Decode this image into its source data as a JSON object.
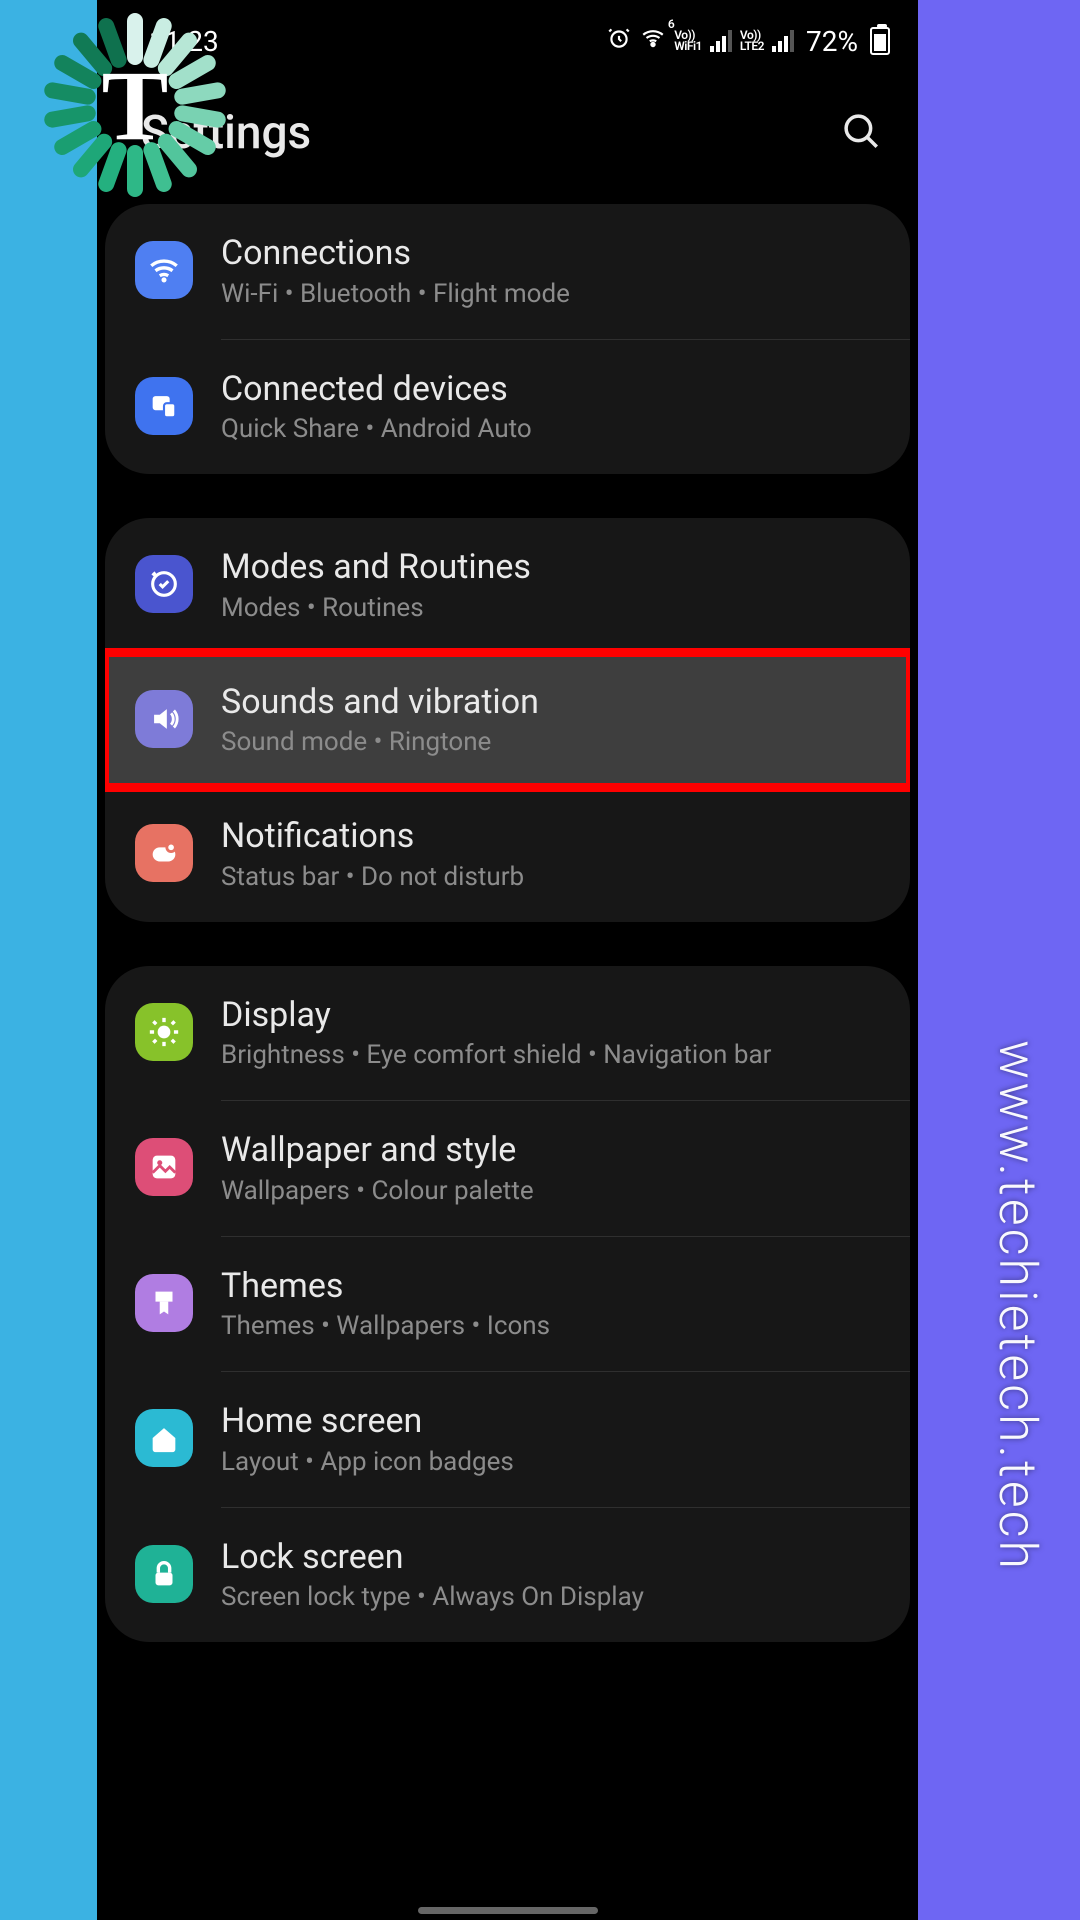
{
  "status": {
    "time": "11:23",
    "wifi_label": "WiFi1",
    "wifi_band": "6",
    "lte_label": "LTE2",
    "vo1": "Vo))",
    "vo2": "Vo))",
    "battery_pct": "72%"
  },
  "header": {
    "title": "Settings"
  },
  "groups": [
    {
      "items": [
        {
          "id": "connections",
          "icon": "wifi",
          "color": "#4f7ff2",
          "title": "Connections",
          "sub": "Wi-Fi  •  Bluetooth  •  Flight mode",
          "highlight": false,
          "selected": false
        },
        {
          "id": "connected-devices",
          "icon": "devices",
          "color": "#3f73ef",
          "title": "Connected devices",
          "sub": "Quick Share  •  Android Auto",
          "highlight": false,
          "selected": false
        }
      ]
    },
    {
      "items": [
        {
          "id": "modes-routines",
          "icon": "routine",
          "color": "#4a55cf",
          "title": "Modes and Routines",
          "sub": "Modes  •  Routines",
          "highlight": false,
          "selected": false
        },
        {
          "id": "sounds-vibration",
          "icon": "sound",
          "color": "#7e7bd8",
          "title": "Sounds and vibration",
          "sub": "Sound mode  •  Ringtone",
          "highlight": true,
          "selected": true
        },
        {
          "id": "notifications",
          "icon": "notif",
          "color": "#e77263",
          "title": "Notifications",
          "sub": "Status bar  •  Do not disturb",
          "highlight": false,
          "selected": false
        }
      ]
    },
    {
      "items": [
        {
          "id": "display",
          "icon": "brightness",
          "color": "#87c22a",
          "title": "Display",
          "sub": "Brightness  •  Eye comfort shield  •  Navigation bar",
          "highlight": false,
          "selected": false
        },
        {
          "id": "wallpaper",
          "icon": "wallpaper",
          "color": "#dd4e77",
          "title": "Wallpaper and style",
          "sub": "Wallpapers  •  Colour palette",
          "highlight": false,
          "selected": false
        },
        {
          "id": "themes",
          "icon": "themes",
          "color": "#b07de2",
          "title": "Themes",
          "sub": "Themes  •  Wallpapers  •  Icons",
          "highlight": false,
          "selected": false
        },
        {
          "id": "home-screen",
          "icon": "home",
          "color": "#2bbad3",
          "title": "Home screen",
          "sub": "Layout  •  App icon badges",
          "highlight": false,
          "selected": false
        },
        {
          "id": "lock-screen",
          "icon": "lock",
          "color": "#1fb296",
          "title": "Lock screen",
          "sub": "Screen lock type  •  Always On Display",
          "highlight": false,
          "selected": false
        }
      ]
    }
  ],
  "watermark": {
    "vertical": "www.techietech.tech",
    "logo_letter": "T"
  },
  "logo_colors": [
    "#d9f2ec",
    "#c9ede2",
    "#b7e7d6",
    "#a2e0ca",
    "#8dd9be",
    "#79d2b2",
    "#65cca7",
    "#52c59c",
    "#3fbf91",
    "#2eb887",
    "#24b07f",
    "#1ea778",
    "#1a9e71",
    "#17956a",
    "#158c63",
    "#13835c",
    "#117a55",
    "#0f714e"
  ]
}
